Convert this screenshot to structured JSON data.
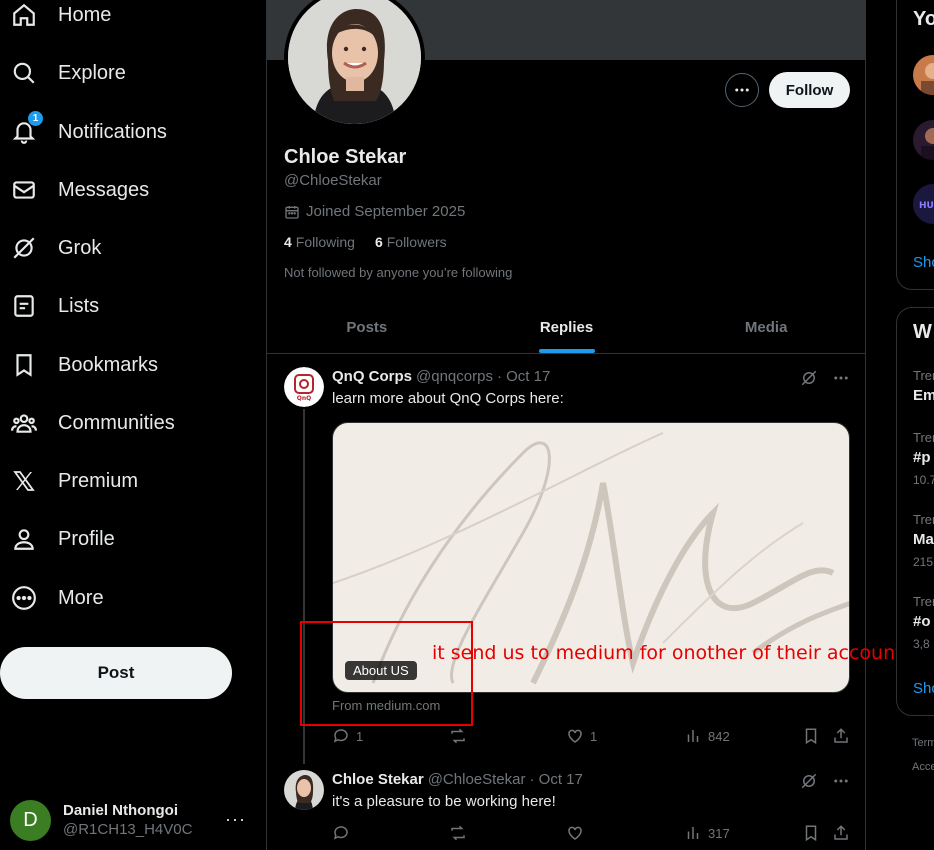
{
  "nav": {
    "items": [
      {
        "label": "Home",
        "icon": "home-icon"
      },
      {
        "label": "Explore",
        "icon": "search-icon"
      },
      {
        "label": "Notifications",
        "icon": "bell-icon",
        "badge": "1"
      },
      {
        "label": "Messages",
        "icon": "envelope-icon"
      },
      {
        "label": "Grok",
        "icon": "grok-icon"
      },
      {
        "label": "Lists",
        "icon": "list-icon"
      },
      {
        "label": "Bookmarks",
        "icon": "bookmark-icon"
      },
      {
        "label": "Communities",
        "icon": "people-icon"
      },
      {
        "label": "Premium",
        "icon": "x-logo-icon"
      },
      {
        "label": "Profile",
        "icon": "person-icon"
      },
      {
        "label": "More",
        "icon": "more-circle-icon"
      }
    ],
    "post_label": "Post"
  },
  "account": {
    "avatar_letter": "D",
    "name": "Daniel Nthongoi",
    "handle": "@R1CH13_H4V0C",
    "more": "···"
  },
  "profile": {
    "name": "Chloe Stekar",
    "handle": "@ChloeStekar",
    "joined": "Joined September 2025",
    "following_count": "4",
    "following_label": "Following",
    "followers_count": "6",
    "followers_label": "Followers",
    "not_followed": "Not followed by anyone you’re following",
    "follow_label": "Follow"
  },
  "tabs": [
    "Posts",
    "Replies",
    "Media"
  ],
  "active_tab": "Replies",
  "tweets": [
    {
      "name": "QnQ Corps",
      "handle": "@qnqcorps",
      "date": "· Oct 17",
      "text": "learn more about QnQ Corps here:",
      "card_label": "About US",
      "card_source": "From medium.com",
      "replies": "1",
      "likes": "1",
      "views": "842"
    },
    {
      "name": "Chloe Stekar",
      "handle": "@ChloeStekar",
      "date": "· Oct 17",
      "text": "it's a pleasure to be working here!",
      "views": "317"
    }
  ],
  "annotation": "it send us to medium for onother of their accounts",
  "right": {
    "box1_title": "Yo",
    "box1_show": "Sho",
    "box2_title": "W",
    "trends": [
      {
        "cat": "Tren",
        "name": "Em",
        "count": ""
      },
      {
        "cat": "Tren",
        "name": "#p",
        "count": "10.7"
      },
      {
        "cat": "Tren",
        "name": "Ma",
        "count": "215"
      },
      {
        "cat": "Tren",
        "name": "#o",
        "count": "3,8"
      }
    ],
    "box2_show": "Sho",
    "footer1": "Term",
    "footer2": "Acce"
  },
  "colors": {
    "accent": "#1d9bf0",
    "annotation": "#e60000",
    "background": "#000000"
  }
}
